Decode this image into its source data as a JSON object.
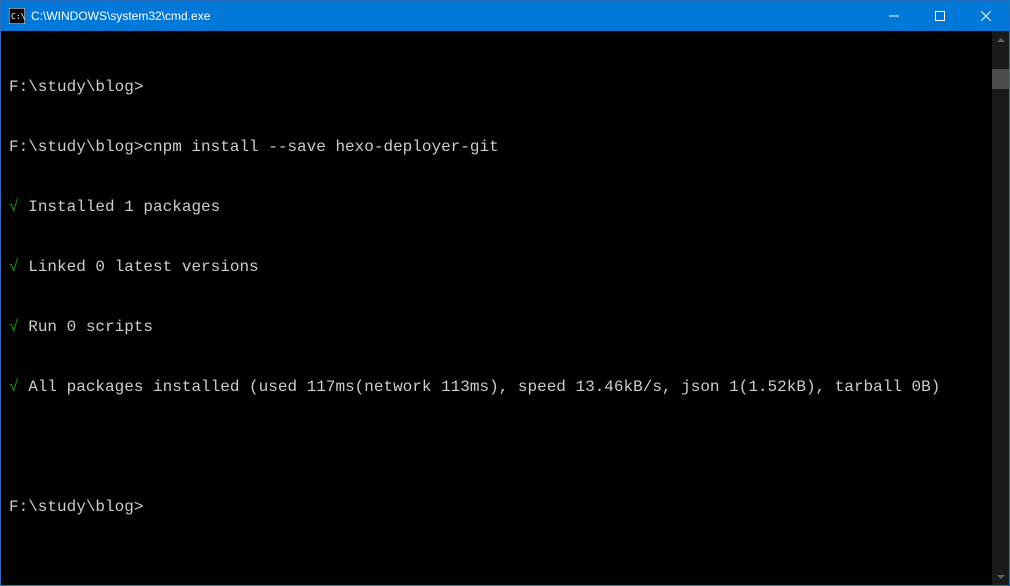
{
  "titlebar": {
    "title": "C:\\WINDOWS\\system32\\cmd.exe"
  },
  "terminal": {
    "lines": [
      {
        "prompt": "F:\\study\\blog>",
        "cmd": ""
      },
      {
        "prompt": "F:\\study\\blog>",
        "cmd": "cnpm install --save hexo-deployer-git"
      },
      {
        "check": "√",
        "out": " Installed 1 packages"
      },
      {
        "check": "√",
        "out": " Linked 0 latest versions"
      },
      {
        "check": "√",
        "out": " Run 0 scripts"
      },
      {
        "check": "√",
        "out": " All packages installed (used 117ms(network 113ms), speed 13.46kB/s, json 1(1.52kB), tarball 0B)"
      },
      {
        "blank": ""
      },
      {
        "prompt": "F:\\study\\blog>",
        "cmd": ""
      }
    ]
  }
}
